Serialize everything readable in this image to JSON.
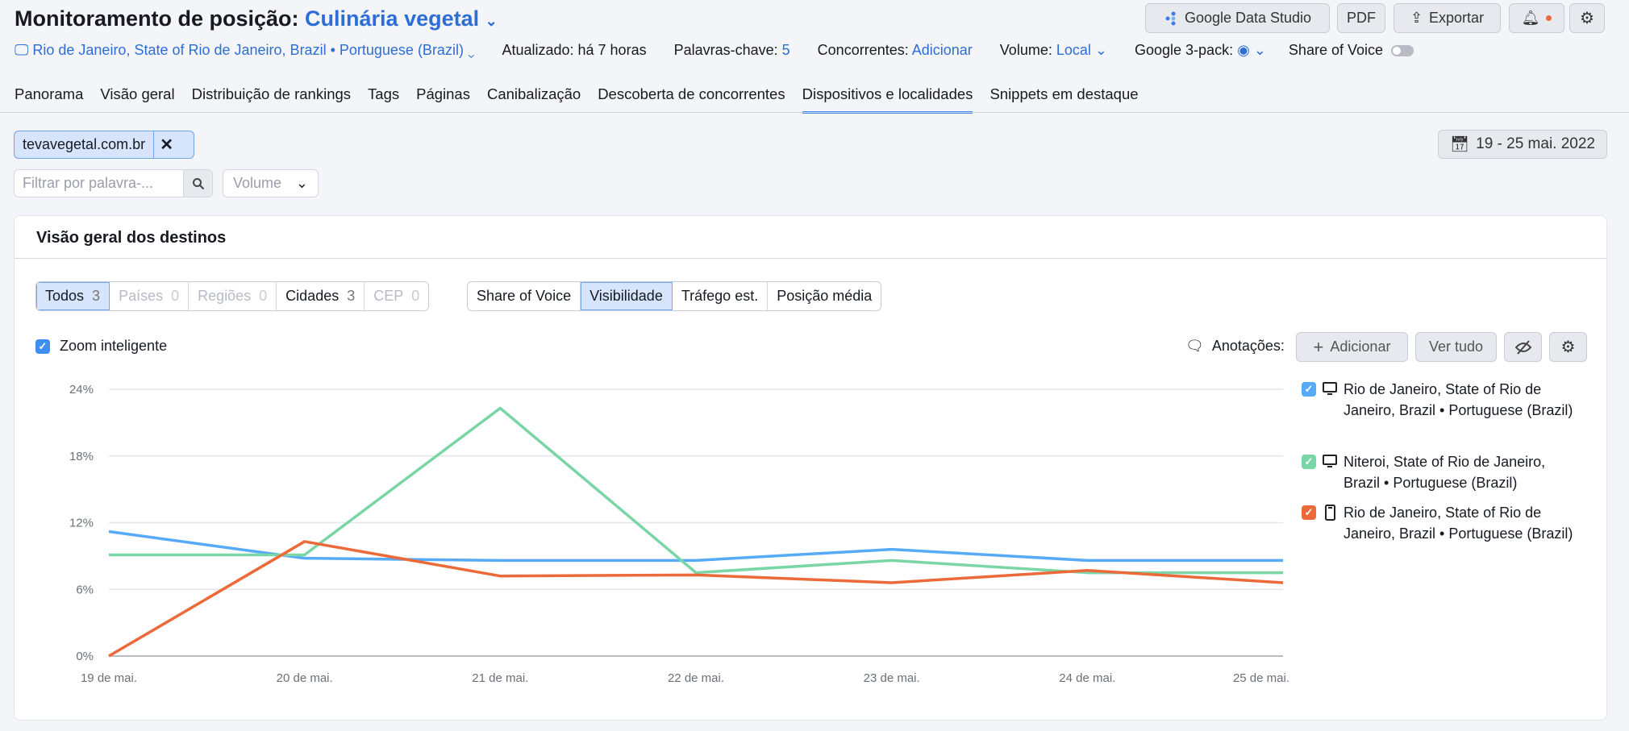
{
  "header": {
    "title_prefix": "Monitoramento de posição:",
    "project": "Culinária vegetal",
    "buttons": {
      "gds": "Google Data Studio",
      "pdf": "PDF",
      "export": "Exportar"
    },
    "location": "Rio de Janeiro, State of Rio de Janeiro, Brazil • Portuguese (Brazil)",
    "updated": "Atualizado: há 7 horas",
    "keywords_label": "Palavras-chave:",
    "keywords_value": "5",
    "competitors_label": "Concorrentes:",
    "competitors_value": "Adicionar",
    "volume_label": "Volume:",
    "volume_value": "Local",
    "pack_label": "Google 3-pack:",
    "sov_label": "Share of Voice",
    "sov_toggle": false
  },
  "tabs": [
    {
      "label": "Panorama"
    },
    {
      "label": "Visão geral"
    },
    {
      "label": "Distribuição de rankings"
    },
    {
      "label": "Tags"
    },
    {
      "label": "Páginas"
    },
    {
      "label": "Canibalização"
    },
    {
      "label": "Descoberta de concorrentes"
    },
    {
      "label": "Dispositivos e localidades",
      "active": true
    },
    {
      "label": "Snippets em destaque"
    }
  ],
  "filters": {
    "domain_chip": "tevavegetal.com.br",
    "search_placeholder": "Filtrar por palavra-...",
    "volume": "Volume",
    "date_range": "19 - 25 mai. 2022"
  },
  "card": {
    "title": "Visão geral dos destinos",
    "scope": [
      {
        "label": "Todos",
        "count": "3",
        "active": true
      },
      {
        "label": "Países",
        "count": "0",
        "disabled": true
      },
      {
        "label": "Regiões",
        "count": "0",
        "disabled": true
      },
      {
        "label": "Cidades",
        "count": "3"
      },
      {
        "label": "CEP",
        "count": "0",
        "disabled": true
      }
    ],
    "metrics": [
      {
        "label": "Share of Voice"
      },
      {
        "label": "Visibilidade",
        "active": true
      },
      {
        "label": "Tráfego est."
      },
      {
        "label": "Posição média"
      }
    ],
    "smart_zoom": "Zoom inteligente",
    "smart_zoom_checked": true,
    "annotations_label": "Anotações:",
    "add_label": "Adicionar",
    "view_all": "Ver tudo"
  },
  "colors": {
    "accent": "#2d6ed6",
    "blue": "#56aaf7",
    "green": "#7ad6a6",
    "orange": "#ec6a3a"
  },
  "chart_data": {
    "type": "line",
    "x": [
      "19 de mai.",
      "20 de mai.",
      "21 de mai.",
      "22 de mai.",
      "23 de mai.",
      "24 de mai.",
      "25 de mai."
    ],
    "yticks": [
      "0%",
      "6%",
      "12%",
      "18%",
      "24%"
    ],
    "ylim": [
      0,
      24
    ],
    "grid": true,
    "legend": "right",
    "series": [
      {
        "name": "Rio de Janeiro, State of Rio de Janeiro, Brazil • Portuguese (Brazil)",
        "device": "desktop-icon",
        "color": "#56aaf7",
        "values": [
          11.2,
          8.8,
          8.6,
          8.6,
          9.6,
          8.6,
          8.6
        ]
      },
      {
        "name": "Niteroi, State of Rio de Janeiro, Brazil • Portuguese (Brazil)",
        "device": "desktop-icon",
        "color": "#7ad6a6",
        "values": [
          9.1,
          9.1,
          22.3,
          7.5,
          8.6,
          7.5,
          7.5
        ]
      },
      {
        "name": "Rio de Janeiro, State of Rio de Janeiro, Brazil • Portuguese (Brazil)",
        "device": "mobile-icon",
        "color": "#ec6a3a",
        "values": [
          0,
          10.3,
          7.2,
          7.3,
          6.6,
          7.7,
          6.6
        ]
      }
    ]
  }
}
